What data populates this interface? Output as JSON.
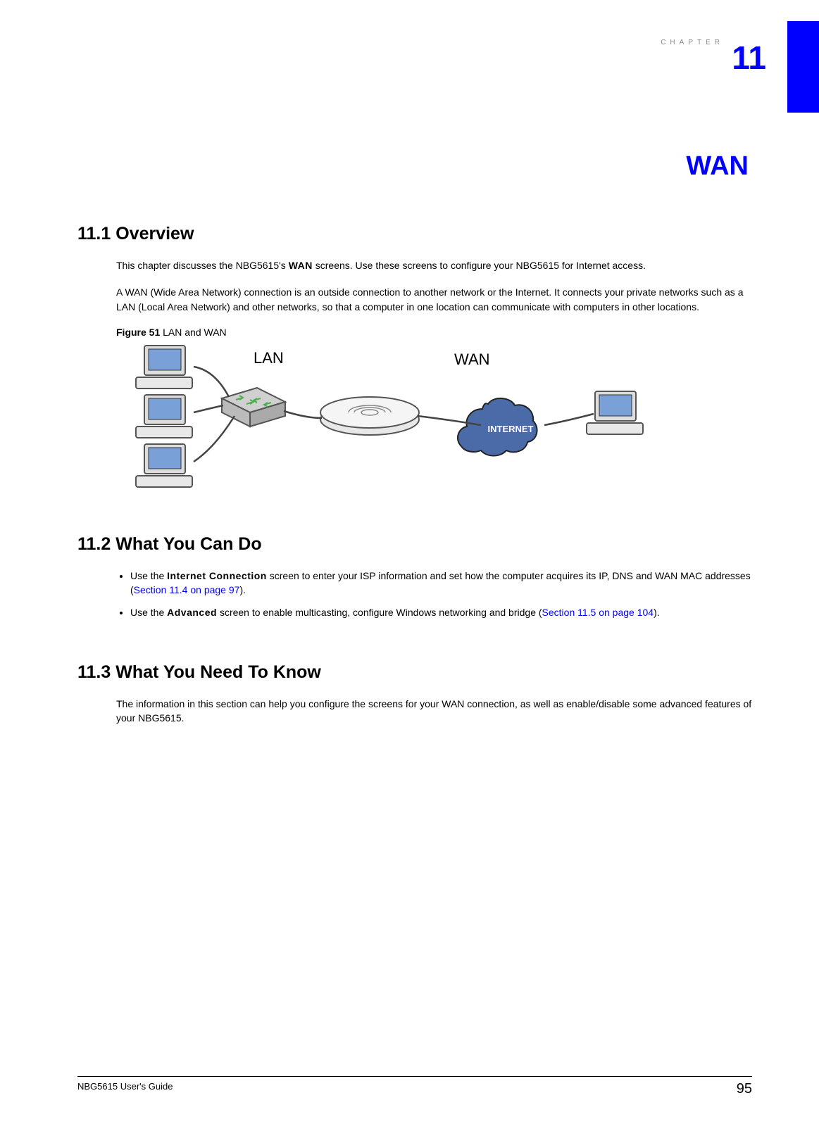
{
  "chapter": {
    "label": "CHAPTER",
    "number": "11",
    "title": "WAN"
  },
  "section1": {
    "heading": "11.1  Overview",
    "para1_a": "This chapter discusses the NBG5615's ",
    "para1_bold": "WAN",
    "para1_b": " screens. Use these screens to configure your NBG5615 for Internet access.",
    "para2": "A WAN (Wide Area Network) connection is an outside connection to another network or the Internet. It connects your private networks such as a LAN (Local Area Network) and other networks, so that a computer in one location can communicate with computers in other locations.",
    "figure": {
      "label": "Figure 51",
      "caption": "   LAN and WAN",
      "lan_label": "LAN",
      "wan_label": "WAN",
      "internet_label": "INTERNET"
    }
  },
  "section2": {
    "heading": "11.2  What You Can Do",
    "b1_a": "Use the ",
    "b1_bold": "Internet Connection",
    "b1_b": " screen to enter your ISP information and set how the computer acquires its IP, DNS and WAN MAC addresses (",
    "b1_link": "Section 11.4 on page 97",
    "b1_c": ").",
    "b2_a": "Use the ",
    "b2_bold": "Advanced",
    "b2_b": " screen to enable multicasting, configure Windows networking and bridge (",
    "b2_link": "Section 11.5 on page 104",
    "b2_c": ")."
  },
  "section3": {
    "heading": "11.3  What You Need To Know",
    "para1": "The information in this section can help you configure the screens for your WAN connection, as well as enable/disable some advanced features of your NBG5615."
  },
  "footer": {
    "guide": "NBG5615 User's Guide",
    "page": "95"
  }
}
